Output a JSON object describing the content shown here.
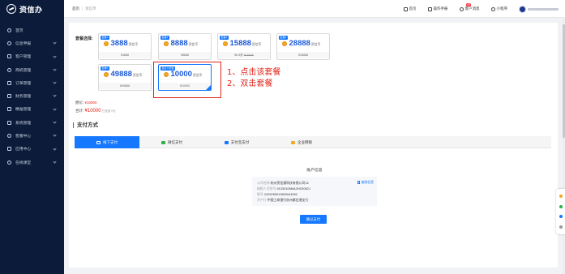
{
  "app": {
    "name": "资信办"
  },
  "sidebar": {
    "items": [
      {
        "label": "首页",
        "icon": "home-icon",
        "chevron": false
      },
      {
        "label": "信息申报",
        "icon": "document-icon",
        "chevron": true
      },
      {
        "label": "客户管理",
        "icon": "user-icon",
        "chevron": true
      },
      {
        "label": "商机管理",
        "icon": "gear-icon",
        "chevron": true
      },
      {
        "label": "订单管理",
        "icon": "order-icon",
        "chevron": true
      },
      {
        "label": "财务管理",
        "icon": "finance-icon",
        "chevron": true
      },
      {
        "label": "精准管理",
        "icon": "target-icon",
        "chevron": true
      },
      {
        "label": "系统管理",
        "icon": "system-icon",
        "chevron": true
      },
      {
        "label": "售服中心",
        "icon": "service-icon",
        "chevron": true
      },
      {
        "label": "应用中心",
        "icon": "app-icon",
        "chevron": true
      },
      {
        "label": "在线课堂",
        "icon": "classroom-icon",
        "chevron": true
      }
    ]
  },
  "breadcrumb": {
    "home": "首页",
    "current": "资信币"
  },
  "topnav": {
    "home": "首页",
    "manual": "操作手册",
    "customers": "客户消息",
    "badge": "99",
    "miniprogram": "小程序"
  },
  "packages": {
    "label": "套餐选择:",
    "cards": [
      {
        "tag": "套餐1",
        "amount": "3888",
        "unit": "资信币",
        "price": "¥3888",
        "orig": ""
      },
      {
        "tag": "套餐2",
        "amount": "8888",
        "unit": "资信币",
        "price": "¥8888",
        "orig": ""
      },
      {
        "tag": "套餐3",
        "amount": "15888",
        "unit": "资信币",
        "price": "¥0.5折",
        "orig": "¥15888"
      },
      {
        "tag": "套餐4",
        "amount": "28888",
        "unit": "资信币",
        "price": "¥28888",
        "orig": ""
      },
      {
        "tag": "套餐5",
        "amount": "49888",
        "unit": "资信币",
        "price": "¥49888",
        "orig": ""
      },
      {
        "tag": "自定义套餐",
        "amount": "10000",
        "unit": "资信币",
        "price": "¥10000",
        "orig": ""
      }
    ]
  },
  "annotation": {
    "step1": "1、点击该套餐",
    "step2": "2、双击套餐"
  },
  "summary": {
    "original_label": "原价:",
    "original_value": "¥10000",
    "total_label": "合计:",
    "total_value": "¥10000",
    "total_note": "已优惠 0元"
  },
  "payment": {
    "title": "支付方式",
    "tabs": [
      {
        "label": "线下支付",
        "icon": "bank-icon",
        "active": true
      },
      {
        "label": "微信支付",
        "icon": "wechat-icon",
        "active": false
      },
      {
        "label": "支付宝支付",
        "icon": "alipay-icon",
        "active": false
      },
      {
        "label": "企业网银",
        "icon": "ebank-icon",
        "active": false
      }
    ],
    "account_title": "账户信息",
    "copy_label": "复制信息",
    "rows": [
      {
        "k": "公司名称:",
        "v": "杭州资信通科技有限公司02"
      },
      {
        "k": "纳税人识别号:",
        "v": "91330106MA2H1E062J"
      },
      {
        "k": "账号:",
        "v": "1202053019800044052"
      },
      {
        "k": "开户行:",
        "v": "中国工商银行杭州紫金港支行"
      }
    ],
    "confirm": "确认支付"
  },
  "colors": {
    "primary": "#1677ff",
    "sidebar": "#0c1b3a",
    "annotation": "#e2231a"
  }
}
